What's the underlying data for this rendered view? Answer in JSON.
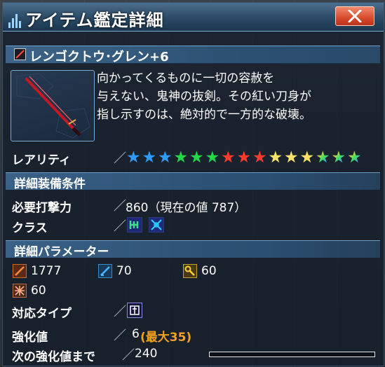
{
  "window": {
    "title": "アイテム鑑定詳細"
  },
  "item": {
    "name": "レンゴクトウ･グレン+6",
    "description_lines": [
      "向かってくるものに一切の容赦を",
      "与えない、鬼神の抜剣。その紅い刀身が",
      "指し示すのは、絶対的で一方的な破壊。"
    ]
  },
  "rarity": {
    "label": "レアリティ",
    "stars": [
      {
        "color": "#2e9bff"
      },
      {
        "color": "#2e9bff"
      },
      {
        "color": "#2e9bff"
      },
      {
        "color": "#22d84a"
      },
      {
        "color": "#22d84a"
      },
      {
        "color": "#22d84a"
      },
      {
        "color": "#ff3a2e"
      },
      {
        "color": "#ff3a2e"
      },
      {
        "color": "#ff3a2e"
      },
      {
        "color": "#ffe26a"
      },
      {
        "color": "#ffe26a"
      },
      {
        "color": "#ffe26a"
      },
      {
        "color": "rainbow"
      },
      {
        "color": "rainbow"
      },
      {
        "color": "rainbow"
      }
    ]
  },
  "requirements": {
    "section_title": "詳細装備条件",
    "attack_label": "必要打撃力",
    "attack_value": "860（現在の値 787）",
    "class_label": "クラス",
    "class_icons": [
      "hunter-class-icon",
      "braver-class-icon"
    ]
  },
  "parameters": {
    "section_title": "詳細パラメーター",
    "melee_attack": "1777",
    "ranged_attack": "70",
    "tech_attack": "60",
    "dexterity": "60",
    "type_label": "対応タイプ",
    "type_icon": "katana-type-icon"
  },
  "enhancement": {
    "label": "強化値",
    "value": "6",
    "max": "(最大35)",
    "next_label": "次の強化値まで",
    "next_value": "240",
    "progress": 0.0
  },
  "colors": {
    "accent": "#f2a21e",
    "close_button": "#d84b2e",
    "header": "#2c5173"
  }
}
